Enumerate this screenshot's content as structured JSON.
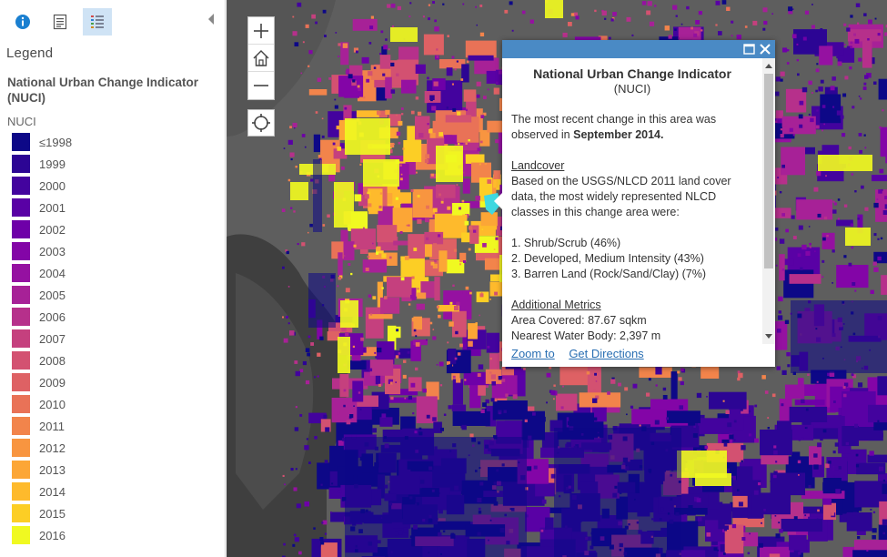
{
  "panel": {
    "tools": [
      {
        "name": "info-tool",
        "icon": "info-icon",
        "active": false
      },
      {
        "name": "details-tool",
        "icon": "document-icon",
        "active": false
      },
      {
        "name": "legend-tool",
        "icon": "legend-list-icon",
        "active": true
      }
    ],
    "collapse_icon": "chevron-left-icon",
    "legend_heading": "Legend",
    "layer_title": "National Urban Change Indicator (NUCI)",
    "field_label": "NUCI",
    "legend_items": [
      {
        "label": "≤1998",
        "color": "#0d0887"
      },
      {
        "label": "1999",
        "color": "#2c0594"
      },
      {
        "label": "2000",
        "color": "#43039e"
      },
      {
        "label": "2001",
        "color": "#5901a5"
      },
      {
        "label": "2002",
        "color": "#6e00a8"
      },
      {
        "label": "2003",
        "color": "#8305a7"
      },
      {
        "label": "2004",
        "color": "#9511a1"
      },
      {
        "label": "2005",
        "color": "#a72197"
      },
      {
        "label": "2006",
        "color": "#b6308b"
      },
      {
        "label": "2007",
        "color": "#c5407e"
      },
      {
        "label": "2008",
        "color": "#d35171"
      },
      {
        "label": "2009",
        "color": "#de6164"
      },
      {
        "label": "2010",
        "color": "#e97257"
      },
      {
        "label": "2011",
        "color": "#f2844b"
      },
      {
        "label": "2012",
        "color": "#f89540"
      },
      {
        "label": "2013",
        "color": "#fca636"
      },
      {
        "label": "2014",
        "color": "#feba2c"
      },
      {
        "label": "2015",
        "color": "#fcce25"
      },
      {
        "label": "2016",
        "color": "#f0f921"
      }
    ]
  },
  "map": {
    "controls": {
      "zoom_in_icon": "plus-icon",
      "home_icon": "home-icon",
      "zoom_out_icon": "minus-icon",
      "locate_icon": "locate-icon"
    },
    "selected_feature_color": "#3fd8e0"
  },
  "popup": {
    "header_color": "#4a8ac5",
    "maximize_icon": "maximize-icon",
    "close_icon": "close-icon",
    "title": "National Urban Change Indicator",
    "subtitle": "(NUCI)",
    "recent_text": "The most recent change in this area was observed in",
    "recent_date": "September 2014.",
    "landcover_heading": "Landcover",
    "landcover_text": "Based on the USGS/NLCD 2011 land cover data, the most widely represented NLCD classes in this change area were:",
    "classes": [
      "1. Shrub/Scrub (46%)",
      "2. Developed, Medium Intensity (43%)",
      "3. Barren Land (Rock/Sand/Clay) (7%)"
    ],
    "metrics_heading": "Additional Metrics",
    "area_covered": "Area Covered:  87.67 sqkm",
    "nearest_water": "Nearest Water Body: 2,397 m",
    "zoom_to": "Zoom to",
    "get_directions": "Get Directions"
  }
}
